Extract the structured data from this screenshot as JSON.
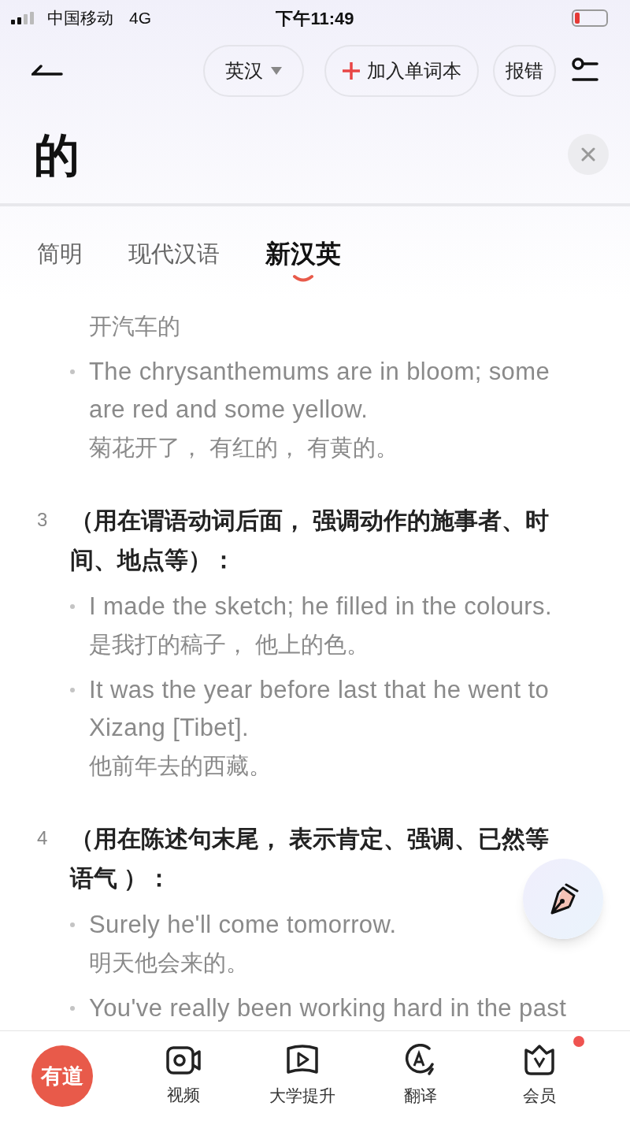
{
  "status_bar": {
    "carrier": "中国移动",
    "network": "4G",
    "time": "下午11:49"
  },
  "header": {
    "language": "英汉",
    "add_button": "加入单词本",
    "report_button": "报错"
  },
  "headword": "的",
  "tabs": [
    {
      "label": "简明",
      "selected": false
    },
    {
      "label": "现代汉语",
      "selected": false
    },
    {
      "label": "新汉英",
      "selected": true
    }
  ],
  "senses": [
    {
      "examples": [
        {
          "zh": "开汽车的"
        },
        {
          "en": "The chrysanthemums are in bloom; some are red and some yellow.",
          "zh": "菊花开了， 有红的， 有黄的。"
        }
      ]
    },
    {
      "number": "3",
      "definition": "（用在谓语动词后面， 强调动作的施事者、时间、地点等）：",
      "examples": [
        {
          "en": "I made the sketch; he filled in the colours.",
          "zh": "是我打的稿子， 他上的色。"
        },
        {
          "en": "It was the year before last that he went to Xizang [Tibet].",
          "zh": "他前年去的西藏。"
        }
      ]
    },
    {
      "number": "4",
      "definition": "（用在陈述句末尾， 表示肯定、强调、已然等语气 ）：",
      "examples": [
        {
          "en": "Surely he'll come tomorrow.",
          "zh": "明天他会来的。"
        },
        {
          "en": "You've really been working hard in the past"
        }
      ]
    }
  ],
  "bottom_nav": {
    "logo": "有道",
    "items": [
      {
        "kind": "video",
        "label": "视频",
        "badge": false
      },
      {
        "kind": "course",
        "label": "大学提升",
        "badge": false
      },
      {
        "kind": "translate",
        "label": "翻译",
        "badge": false
      },
      {
        "kind": "vip",
        "label": "会员",
        "badge": true
      }
    ]
  }
}
